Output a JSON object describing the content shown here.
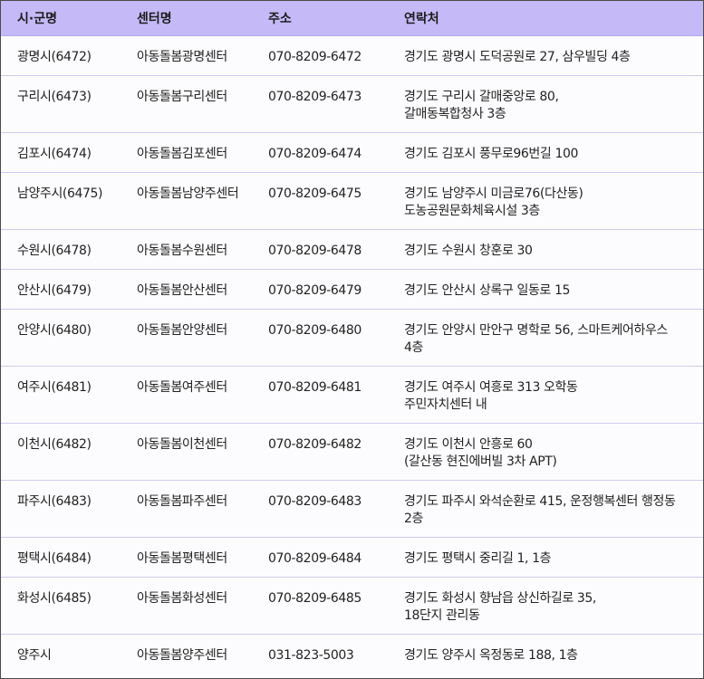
{
  "table": {
    "headers": [
      "시·군명",
      "센터명",
      "주소",
      "연락처"
    ],
    "rows": [
      {
        "city": "광명시(6472)",
        "center": "아동돌봄광명센터",
        "phone": "070-8209-6472",
        "address": [
          "경기도 광명시 도덕공원로 27, 삼우빌딩 4층"
        ]
      },
      {
        "city": "구리시(6473)",
        "center": "아동돌봄구리센터",
        "phone": "070-8209-6473",
        "address": [
          "경기도 구리시 갈매중앙로 80,",
          "갈매동복합청사 3층"
        ]
      },
      {
        "city": "김포시(6474)",
        "center": "아동돌봄김포센터",
        "phone": "070-8209-6474",
        "address": [
          "경기도 김포시 풍무로96번길 100"
        ]
      },
      {
        "city": "남양주시(6475)",
        "center": "아동돌봄남양주센터",
        "phone": "070-8209-6475",
        "address": [
          "경기도 남양주시 미금로76(다산동)",
          "도농공원문화체육시설 3층"
        ]
      },
      {
        "city": "수원시(6478)",
        "center": "아동돌봄수원센터",
        "phone": "070-8209-6478",
        "address": [
          "경기도 수원시 창훈로 30"
        ]
      },
      {
        "city": "안산시(6479)",
        "center": "아동돌봄안산센터",
        "phone": "070-8209-6479",
        "address": [
          "경기도 안산시 상록구 일동로 15"
        ]
      },
      {
        "city": "안양시(6480)",
        "center": "아동돌봄안양센터",
        "phone": "070-8209-6480",
        "address": [
          "경기도 안양시 만안구 명학로 56, 스마트케어하우스",
          "4층"
        ]
      },
      {
        "city": "여주시(6481)",
        "center": "아동돌봄여주센터",
        "phone": "070-8209-6481",
        "address": [
          "경기도 여주시 여흥로 313 오학동",
          "주민자치센터 내"
        ]
      },
      {
        "city": "이천시(6482)",
        "center": "아동돌봄이천센터",
        "phone": "070-8209-6482",
        "address": [
          "경기도 이천시 안흥로 60",
          "(갈산동 현진에버빌 3차 APT)"
        ]
      },
      {
        "city": "파주시(6483)",
        "center": "아동돌봄파주센터",
        "phone": "070-8209-6483",
        "address": [
          "경기도 파주시 와석순환로 415, 운정행복센터 행정동",
          "2층"
        ]
      },
      {
        "city": "평택시(6484)",
        "center": "아동돌봄평택센터",
        "phone": "070-8209-6484",
        "address": [
          "경기도 평택시 중리길 1, 1층"
        ]
      },
      {
        "city": "화성시(6485)",
        "center": "아동돌봄화성센터",
        "phone": "070-8209-6485",
        "address": [
          "경기도 화성시 향남읍 상신하길로 35,",
          "18단지 관리동"
        ]
      },
      {
        "city": "양주시",
        "center": "아동돌봄양주센터",
        "phone": "031-823-5003",
        "address": [
          "경기도 양주시 옥정동로 188, 1층"
        ]
      }
    ]
  }
}
